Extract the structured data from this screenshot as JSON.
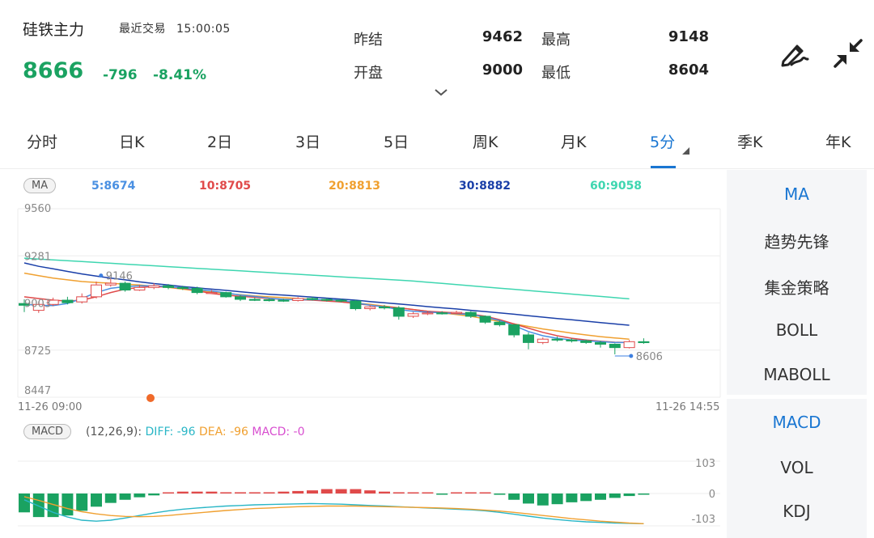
{
  "header": {
    "name": "硅铁主力",
    "recent_label": "最近交易",
    "time": "15:00:05",
    "price": "8666",
    "change": "-796",
    "change_pct": "-8.41%",
    "stats": [
      {
        "label": "昨结",
        "value": "9462"
      },
      {
        "label": "最高",
        "value": "9148"
      },
      {
        "label": "开盘",
        "value": "9000"
      },
      {
        "label": "最低",
        "value": "8604"
      }
    ]
  },
  "tabs": [
    {
      "label": "分时"
    },
    {
      "label": "日K"
    },
    {
      "label": "2日"
    },
    {
      "label": "3日"
    },
    {
      "label": "5日"
    },
    {
      "label": "周K"
    },
    {
      "label": "月K"
    },
    {
      "label": "5分",
      "active": true
    },
    {
      "label": "季K"
    },
    {
      "label": "年K"
    }
  ],
  "side_top": [
    "MA",
    "趋势先锋",
    "集金策略",
    "BOLL",
    "MABOLL"
  ],
  "side_bottom": [
    "MACD",
    "VOL",
    "KDJ"
  ],
  "ma_legend": {
    "chip": "MA",
    "items": [
      {
        "text": "5:8674",
        "color": "#4a90e2"
      },
      {
        "text": "10:8705",
        "color": "#e04a4a"
      },
      {
        "text": "20:8813",
        "color": "#f0a030"
      },
      {
        "text": "30:8882",
        "color": "#1a3fa8"
      },
      {
        "text": "60:9058",
        "color": "#3ed6b0"
      }
    ]
  },
  "macd_legend": {
    "chip": "MACD",
    "params": "(12,26,9):",
    "diff": "DIFF: -96",
    "dea": "DEA: -96",
    "macd": "MACD: -0"
  },
  "chart_data": {
    "type": "candlestick",
    "price_axis": [
      "9560",
      "9281",
      "9003",
      "8725",
      "8447"
    ],
    "ylim": [
      8447,
      9560
    ],
    "time_start": "11-26 09:00",
    "time_end": "11-26 14:55",
    "high_marker": "9146",
    "low_marker": "8606",
    "candles": [
      [
        9000,
        8990,
        9025,
        8950
      ],
      [
        8960,
        8995,
        9010,
        8945
      ],
      [
        8995,
        9020,
        9035,
        8985
      ],
      [
        9020,
        9005,
        9040,
        8995
      ],
      [
        9010,
        9040,
        9060,
        9000
      ],
      [
        9040,
        9110,
        9130,
        9030
      ],
      [
        9110,
        9120,
        9146,
        9100
      ],
      [
        9120,
        9080,
        9130,
        9070
      ],
      [
        9080,
        9095,
        9110,
        9075
      ],
      [
        9095,
        9105,
        9120,
        9085
      ],
      [
        9105,
        9095,
        9115,
        9085
      ],
      [
        9095,
        9090,
        9105,
        9080
      ],
      [
        9090,
        9065,
        9100,
        9055
      ],
      [
        9065,
        9065,
        9080,
        9060
      ],
      [
        9065,
        9040,
        9070,
        9035
      ],
      [
        9040,
        9025,
        9050,
        9015
      ],
      [
        9025,
        9023,
        9035,
        9015
      ],
      [
        9023,
        9020,
        9030,
        9012
      ],
      [
        9020,
        9018,
        9028,
        9010
      ],
      [
        9018,
        9030,
        9038,
        9012
      ],
      [
        9030,
        9025,
        9040,
        9018
      ],
      [
        9025,
        9020,
        9032,
        9012
      ],
      [
        9020,
        9015,
        9028,
        9008
      ],
      [
        9015,
        8970,
        9022,
        8960
      ],
      [
        8970,
        8980,
        8990,
        8960
      ],
      [
        8980,
        8975,
        8992,
        8965
      ],
      [
        8975,
        8925,
        8985,
        8905
      ],
      [
        8925,
        8940,
        8950,
        8915
      ],
      [
        8940,
        8945,
        8955,
        8932
      ],
      [
        8945,
        8942,
        8955,
        8935
      ],
      [
        8942,
        8948,
        8958,
        8938
      ],
      [
        8948,
        8925,
        8955,
        8915
      ],
      [
        8925,
        8890,
        8930,
        8880
      ],
      [
        8890,
        8875,
        8900,
        8865
      ],
      [
        8875,
        8815,
        8880,
        8800
      ],
      [
        8815,
        8770,
        8830,
        8730
      ],
      [
        8770,
        8790,
        8800,
        8760
      ],
      [
        8790,
        8785,
        8805,
        8775
      ],
      [
        8785,
        8780,
        8795,
        8770
      ],
      [
        8780,
        8770,
        8788,
        8762
      ],
      [
        8770,
        8760,
        8780,
        8740
      ],
      [
        8760,
        8740,
        8765,
        8700
      ],
      [
        8740,
        8775,
        8785,
        8735
      ],
      [
        8775,
        8770,
        8795,
        8762
      ]
    ],
    "ma5": [
      8995,
      8990,
      8988,
      9000,
      9030,
      9065,
      9090,
      9100,
      9105,
      9105,
      9100,
      9092,
      9083,
      9075,
      9063,
      9050,
      9042,
      9032,
      9025,
      9022,
      9024,
      9022,
      9020,
      9005,
      8990,
      8980,
      8965,
      8955,
      8950,
      8945,
      8940,
      8935,
      8920,
      8900,
      8870,
      8835,
      8810,
      8795,
      8785,
      8780,
      8775,
      8770,
      8770,
      8674
    ],
    "ma10": [
      9040,
      9030,
      9020,
      9015,
      9020,
      9040,
      9065,
      9085,
      9095,
      9100,
      9098,
      9090,
      9075,
      9060,
      9050,
      9043,
      9037,
      9030,
      9025,
      9023,
      9020,
      9015,
      9010,
      9000,
      8990,
      8982,
      8975,
      8965,
      8955,
      8950,
      8945,
      8938,
      8925,
      8905,
      8880,
      8855,
      8830,
      8810,
      8795,
      8785,
      8778,
      8772,
      8770,
      8705
    ],
    "ma20": [
      9180,
      9165,
      9150,
      9140,
      9130,
      9125,
      9120,
      9115,
      9110,
      9102,
      9095,
      9085,
      9075,
      9068,
      9060,
      9052,
      9045,
      9040,
      9035,
      9030,
      9025,
      9018,
      9010,
      9002,
      8995,
      8985,
      8975,
      8965,
      8955,
      8945,
      8935,
      8925,
      8910,
      8895,
      8880,
      8865,
      8850,
      8838,
      8826,
      8815,
      8805,
      8797,
      8790,
      8813
    ],
    "ma30": [
      9240,
      9220,
      9205,
      9190,
      9175,
      9162,
      9150,
      9140,
      9128,
      9118,
      9110,
      9100,
      9093,
      9085,
      9078,
      9070,
      9062,
      9055,
      9050,
      9044,
      9038,
      9032,
      9026,
      9020,
      9012,
      9005,
      8998,
      8990,
      8982,
      8975,
      8968,
      8960,
      8953,
      8945,
      8937,
      8928,
      8920,
      8912,
      8904,
      8896,
      8888,
      8880,
      8872,
      8882
    ],
    "ma60": [
      9268,
      9263,
      9258,
      9253,
      9248,
      9243,
      9238,
      9233,
      9228,
      9223,
      9218,
      9213,
      9208,
      9203,
      9198,
      9193,
      9188,
      9183,
      9178,
      9173,
      9168,
      9163,
      9158,
      9153,
      9148,
      9143,
      9138,
      9133,
      9126,
      9119,
      9112,
      9105,
      9098,
      9091,
      9084,
      9077,
      9070,
      9063,
      9056,
      9049,
      9042,
      9035,
      9028,
      9058
    ],
    "macd_axis": [
      "103",
      "0",
      "-103"
    ],
    "macd_ylim": [
      -103,
      103
    ],
    "macd_hist": [
      -60,
      -75,
      -75,
      -70,
      -55,
      -42,
      -30,
      -20,
      -12,
      -6,
      0,
      6,
      6,
      6,
      4,
      4,
      4,
      4,
      6,
      8,
      10,
      14,
      14,
      14,
      10,
      6,
      4,
      2,
      0,
      -2,
      0,
      2,
      0,
      -4,
      -20,
      -32,
      -38,
      -34,
      -28,
      -24,
      -20,
      -14,
      -8,
      -2
    ],
    "macd_diff": [
      -20,
      -40,
      -60,
      -75,
      -85,
      -88,
      -85,
      -78,
      -70,
      -62,
      -55,
      -50,
      -46,
      -43,
      -40,
      -38,
      -36,
      -35,
      -34,
      -33,
      -32,
      -33,
      -34,
      -36,
      -38,
      -40,
      -42,
      -44,
      -46,
      -48,
      -50,
      -52,
      -55,
      -60,
      -66,
      -72,
      -78,
      -83,
      -87,
      -90,
      -92,
      -94,
      -95,
      -96
    ],
    "macd_dea": [
      -10,
      -22,
      -35,
      -48,
      -58,
      -65,
      -70,
      -73,
      -74,
      -73,
      -70,
      -66,
      -62,
      -58,
      -54,
      -51,
      -48,
      -46,
      -44,
      -42,
      -41,
      -40,
      -40,
      -40,
      -41,
      -42,
      -43,
      -44,
      -45,
      -46,
      -48,
      -50,
      -53,
      -56,
      -60,
      -65,
      -70,
      -75,
      -80,
      -84,
      -88,
      -91,
      -94,
      -96
    ]
  }
}
